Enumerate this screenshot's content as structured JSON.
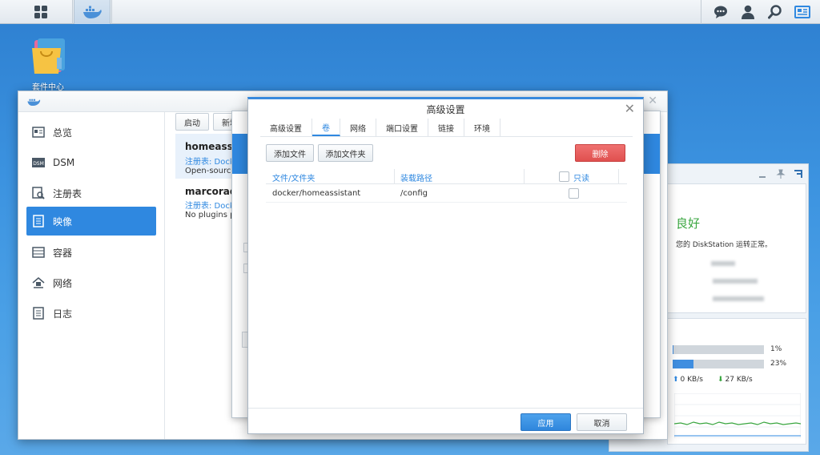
{
  "taskbar": {
    "main_menu_icon": "grid-icon",
    "docker_app_icon": "docker-whale-icon",
    "right_icons": [
      "chat-icon",
      "user-icon",
      "search-icon",
      "widgets-icon"
    ]
  },
  "desktop": {
    "icon_label": "套件中心"
  },
  "docker_window": {
    "sidebar": [
      {
        "label": "总览",
        "icon": "overview-icon"
      },
      {
        "label": "DSM",
        "icon": "dsm-icon"
      },
      {
        "label": "注册表",
        "icon": "registry-icon"
      },
      {
        "label": "映像",
        "icon": "image-icon"
      },
      {
        "label": "容器",
        "icon": "container-icon"
      },
      {
        "label": "网络",
        "icon": "network-icon"
      },
      {
        "label": "日志",
        "icon": "log-icon"
      }
    ],
    "toolbar": {
      "launch": "启动",
      "new_partial": "新增"
    },
    "images": [
      {
        "title": "homeassist",
        "sub": "注册表: Dock",
        "desc": "Open-source"
      },
      {
        "title": "marcorad",
        "sub": "注册表: Dock",
        "desc": "No plugins p"
      }
    ]
  },
  "advanced": {
    "title": "高级设置",
    "tabs": [
      "高级设置",
      "卷",
      "网络",
      "端口设置",
      "链接",
      "环境"
    ],
    "active_tab": 1,
    "add_file": "添加文件",
    "add_folder": "添加文件夹",
    "delete": "删除",
    "columns": {
      "file": "文件/文件夹",
      "mount": "装载路径",
      "readonly": "只读"
    },
    "rows": [
      {
        "file": "docker/homeassistant",
        "mount": "/config",
        "readonly": false
      }
    ],
    "apply": "应用",
    "cancel": "取消"
  },
  "widget": {
    "status": "良好",
    "status_desc": "您的 DiskStation 运转正常。",
    "cpu_percent": "1%",
    "ram_percent": "23%",
    "cpu_level": 0.01,
    "ram_level": 0.23,
    "upload": "0 KB/s",
    "download": "27 KB/s",
    "colors": {
      "good": "#3aa640",
      "bar": "#3f8ee0",
      "download": "#3aa640",
      "upload": "#2f88e0"
    }
  }
}
